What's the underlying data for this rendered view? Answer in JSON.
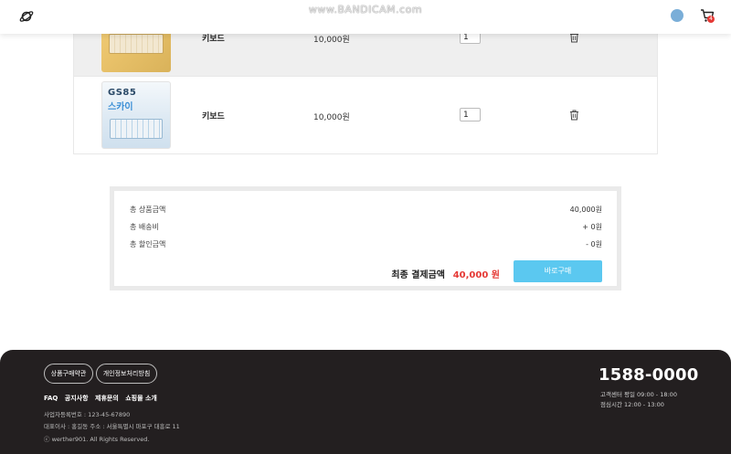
{
  "header": {
    "watermark": "www.BANDICAM.com",
    "logo_icon": "planet-logo-icon",
    "user_icon": "user-avatar-icon",
    "cart_icon": "cart-icon",
    "cart_count": "4"
  },
  "cart": {
    "items": [
      {
        "name": "키보드",
        "price": "10,000원",
        "quantity": "1"
      },
      {
        "name": "키보드",
        "price": "10,000원",
        "quantity": "1",
        "image_text_1": "GS85",
        "image_text_2": "스카이"
      }
    ]
  },
  "summary": {
    "product_total_label": "총 상품금액",
    "product_total_value": "40,000원",
    "shipping_label": "총 배송비",
    "shipping_value": "+ 0원",
    "discount_label": "총 할인금액",
    "discount_value": "- 0원",
    "final_label": "최종 결제금액",
    "final_amount": "40,000 원",
    "buy_button": "바로구매"
  },
  "footer": {
    "terms_button": "상품구매약관",
    "privacy_button": "개인정보처리방침",
    "links": [
      "FAQ",
      "공지사항",
      "제휴문의",
      "쇼핑몰 소개"
    ],
    "business_number": "사업자등록번호 : 123-45-67890",
    "ceo_address": "대표이사 : 홍길동  주소 : 서울특별시 마포구 대흥로 11",
    "copyright": "ⓒ werther901. All Rights Reserved.",
    "phone": "1588-0000",
    "hours_1": "고객센터 평일 09:00 - 18:00",
    "hours_2": "점심시간 12:00 - 13:00"
  },
  "colors": {
    "accent": "#5bc8f0",
    "price_red": "#e53935",
    "footer_bg": "#231f20"
  }
}
